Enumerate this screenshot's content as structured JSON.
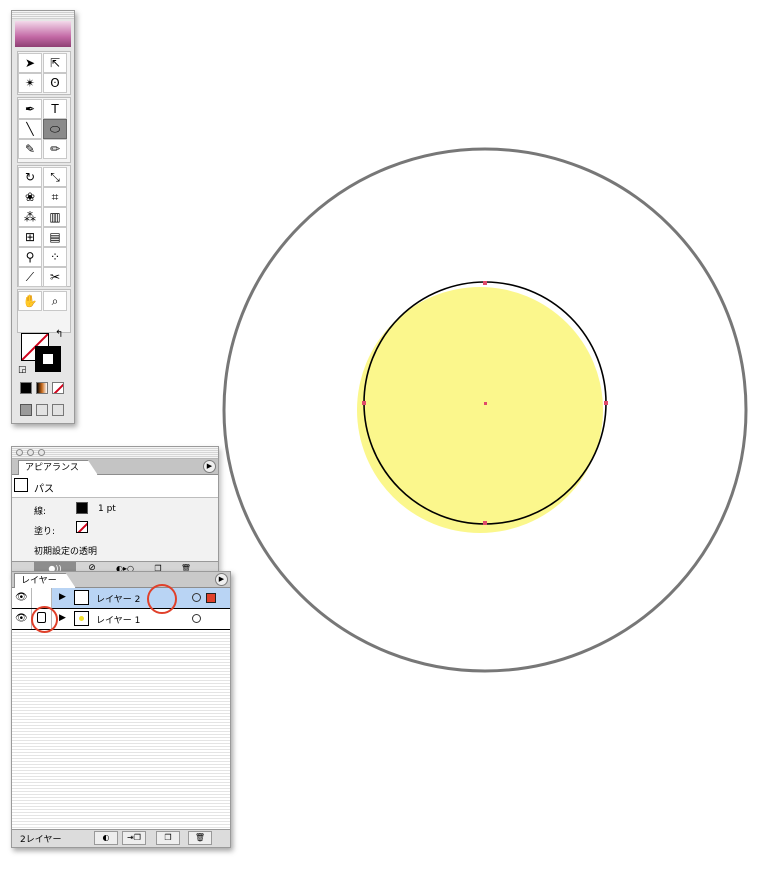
{
  "toolbox": {
    "tools": [
      {
        "name": "selection-tool-icon",
        "glyph": "➤"
      },
      {
        "name": "direct-selection-tool-icon",
        "glyph": "⇱"
      },
      {
        "name": "magic-wand-tool-icon",
        "glyph": "✴"
      },
      {
        "name": "lasso-tool-icon",
        "glyph": "ʘ"
      },
      {
        "name": "pen-tool-icon",
        "glyph": "✒"
      },
      {
        "name": "type-tool-icon",
        "glyph": "T"
      },
      {
        "name": "line-tool-icon",
        "glyph": "╲"
      },
      {
        "name": "ellipse-tool-icon",
        "glyph": "⬭"
      },
      {
        "name": "paintbrush-tool-icon",
        "glyph": "✎"
      },
      {
        "name": "pencil-tool-icon",
        "glyph": "✏"
      },
      {
        "name": "rotate-tool-icon",
        "glyph": "↻"
      },
      {
        "name": "scale-tool-icon",
        "glyph": "⤡"
      },
      {
        "name": "warp-tool-icon",
        "glyph": "❀"
      },
      {
        "name": "free-transform-tool-icon",
        "glyph": "⌗"
      },
      {
        "name": "symbol-sprayer-tool-icon",
        "glyph": "⁂"
      },
      {
        "name": "column-graph-tool-icon",
        "glyph": "▥"
      },
      {
        "name": "mesh-tool-icon",
        "glyph": "⊞"
      },
      {
        "name": "gradient-tool-icon",
        "glyph": "▤"
      },
      {
        "name": "eyedropper-tool-icon",
        "glyph": "⚲"
      },
      {
        "name": "blend-tool-icon",
        "glyph": "⁘"
      },
      {
        "name": "slice-tool-icon",
        "glyph": "⟋"
      },
      {
        "name": "scissors-tool-icon",
        "glyph": "✂"
      },
      {
        "name": "hand-tool-icon",
        "glyph": "✋"
      },
      {
        "name": "zoom-tool-icon",
        "glyph": "⌕"
      }
    ],
    "fill_color": "none",
    "stroke_color": "#000000"
  },
  "appearance": {
    "tab_label": "アピアランス",
    "object_label": "パス",
    "stroke_label": "線:",
    "stroke_value": "1 pt",
    "fill_label": "塗り:",
    "transparency_label": "初期設定の透明"
  },
  "layers": {
    "tab_label": "レイヤー",
    "items": [
      {
        "label": "レイヤー 2",
        "selected": true,
        "color": "#e0402a"
      },
      {
        "label": "レイヤー 1",
        "selected": false,
        "locked": true
      }
    ],
    "count_label": "2レイヤー"
  },
  "canvas": {
    "fill_color": "#fbf78c",
    "stroke_color": "#000000",
    "anchor_color": "#e04a6a"
  },
  "colors": {
    "selection_row": "#b9d4f4",
    "highlight_ring": "#e0402a"
  }
}
